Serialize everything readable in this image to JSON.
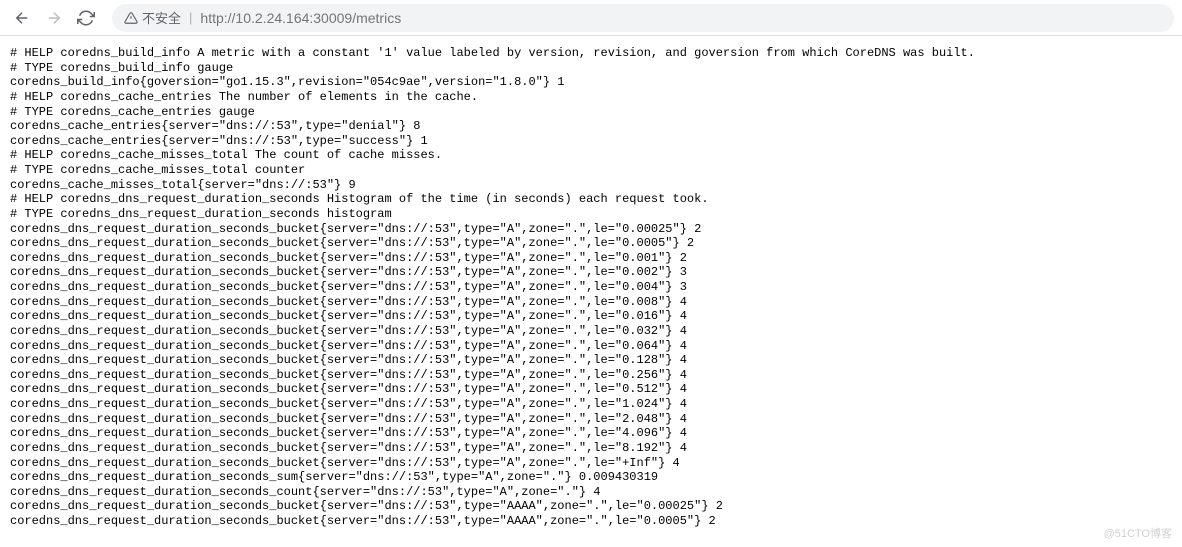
{
  "toolbar": {
    "insecure_label": "不安全",
    "url": "http://10.2.24.164:30009/metrics"
  },
  "watermark": "@51CTO博客",
  "metrics": {
    "lines": [
      "# HELP coredns_build_info A metric with a constant '1' value labeled by version, revision, and goversion from which CoreDNS was built.",
      "# TYPE coredns_build_info gauge",
      "coredns_build_info{goversion=\"go1.15.3\",revision=\"054c9ae\",version=\"1.8.0\"} 1",
      "# HELP coredns_cache_entries The number of elements in the cache.",
      "# TYPE coredns_cache_entries gauge",
      "coredns_cache_entries{server=\"dns://:53\",type=\"denial\"} 8",
      "coredns_cache_entries{server=\"dns://:53\",type=\"success\"} 1",
      "# HELP coredns_cache_misses_total The count of cache misses.",
      "# TYPE coredns_cache_misses_total counter",
      "coredns_cache_misses_total{server=\"dns://:53\"} 9",
      "# HELP coredns_dns_request_duration_seconds Histogram of the time (in seconds) each request took.",
      "# TYPE coredns_dns_request_duration_seconds histogram",
      "coredns_dns_request_duration_seconds_bucket{server=\"dns://:53\",type=\"A\",zone=\".\",le=\"0.00025\"} 2",
      "coredns_dns_request_duration_seconds_bucket{server=\"dns://:53\",type=\"A\",zone=\".\",le=\"0.0005\"} 2",
      "coredns_dns_request_duration_seconds_bucket{server=\"dns://:53\",type=\"A\",zone=\".\",le=\"0.001\"} 2",
      "coredns_dns_request_duration_seconds_bucket{server=\"dns://:53\",type=\"A\",zone=\".\",le=\"0.002\"} 3",
      "coredns_dns_request_duration_seconds_bucket{server=\"dns://:53\",type=\"A\",zone=\".\",le=\"0.004\"} 3",
      "coredns_dns_request_duration_seconds_bucket{server=\"dns://:53\",type=\"A\",zone=\".\",le=\"0.008\"} 4",
      "coredns_dns_request_duration_seconds_bucket{server=\"dns://:53\",type=\"A\",zone=\".\",le=\"0.016\"} 4",
      "coredns_dns_request_duration_seconds_bucket{server=\"dns://:53\",type=\"A\",zone=\".\",le=\"0.032\"} 4",
      "coredns_dns_request_duration_seconds_bucket{server=\"dns://:53\",type=\"A\",zone=\".\",le=\"0.064\"} 4",
      "coredns_dns_request_duration_seconds_bucket{server=\"dns://:53\",type=\"A\",zone=\".\",le=\"0.128\"} 4",
      "coredns_dns_request_duration_seconds_bucket{server=\"dns://:53\",type=\"A\",zone=\".\",le=\"0.256\"} 4",
      "coredns_dns_request_duration_seconds_bucket{server=\"dns://:53\",type=\"A\",zone=\".\",le=\"0.512\"} 4",
      "coredns_dns_request_duration_seconds_bucket{server=\"dns://:53\",type=\"A\",zone=\".\",le=\"1.024\"} 4",
      "coredns_dns_request_duration_seconds_bucket{server=\"dns://:53\",type=\"A\",zone=\".\",le=\"2.048\"} 4",
      "coredns_dns_request_duration_seconds_bucket{server=\"dns://:53\",type=\"A\",zone=\".\",le=\"4.096\"} 4",
      "coredns_dns_request_duration_seconds_bucket{server=\"dns://:53\",type=\"A\",zone=\".\",le=\"8.192\"} 4",
      "coredns_dns_request_duration_seconds_bucket{server=\"dns://:53\",type=\"A\",zone=\".\",le=\"+Inf\"} 4",
      "coredns_dns_request_duration_seconds_sum{server=\"dns://:53\",type=\"A\",zone=\".\"} 0.009430319",
      "coredns_dns_request_duration_seconds_count{server=\"dns://:53\",type=\"A\",zone=\".\"} 4",
      "coredns_dns_request_duration_seconds_bucket{server=\"dns://:53\",type=\"AAAA\",zone=\".\",le=\"0.00025\"} 2",
      "coredns_dns_request_duration_seconds_bucket{server=\"dns://:53\",type=\"AAAA\",zone=\".\",le=\"0.0005\"} 2"
    ]
  }
}
